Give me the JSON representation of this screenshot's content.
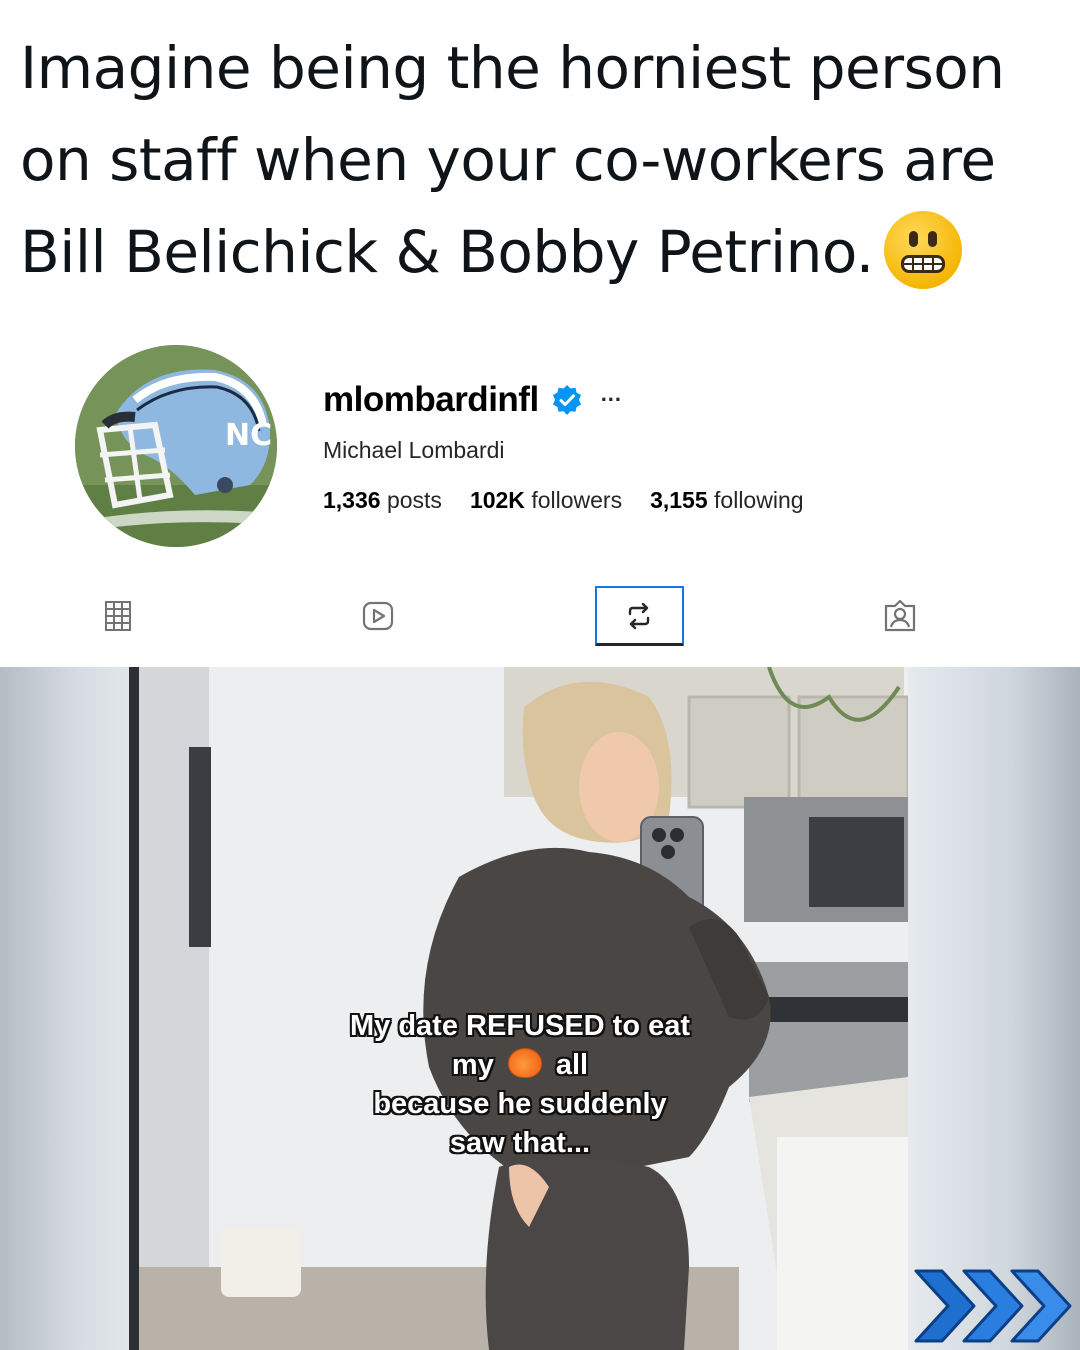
{
  "tweet": {
    "lines": [
      "Imagine being the horniest person",
      "on staff when your co-workers are",
      "Bill Belichick & Bobby Petrino."
    ],
    "emoji": "grimacing-face"
  },
  "profile": {
    "username": "mlombardinfl",
    "verified": true,
    "more_label": "...",
    "full_name": "Michael Lombardi",
    "stats": {
      "posts_count": "1,336",
      "posts_label": "posts",
      "followers_count": "102K",
      "followers_label": "followers",
      "following_count": "3,155",
      "following_label": "following"
    }
  },
  "tabs": [
    {
      "name": "posts",
      "icon": "grid-icon",
      "active": false
    },
    {
      "name": "reels",
      "icon": "reels-icon",
      "active": false
    },
    {
      "name": "reposts",
      "icon": "repost-icon",
      "active": true
    },
    {
      "name": "tagged",
      "icon": "tagged-icon",
      "active": false
    }
  ],
  "media": {
    "caption_lines": [
      "My date REFUSED to eat",
      "my",
      "all",
      "because he suddenly",
      "saw that..."
    ],
    "caption_emoji": "peach"
  },
  "colors": {
    "accent_blue": "#1a73e8",
    "verified_blue": "#0095f6",
    "arrow_blue": "#1f6fd1"
  }
}
